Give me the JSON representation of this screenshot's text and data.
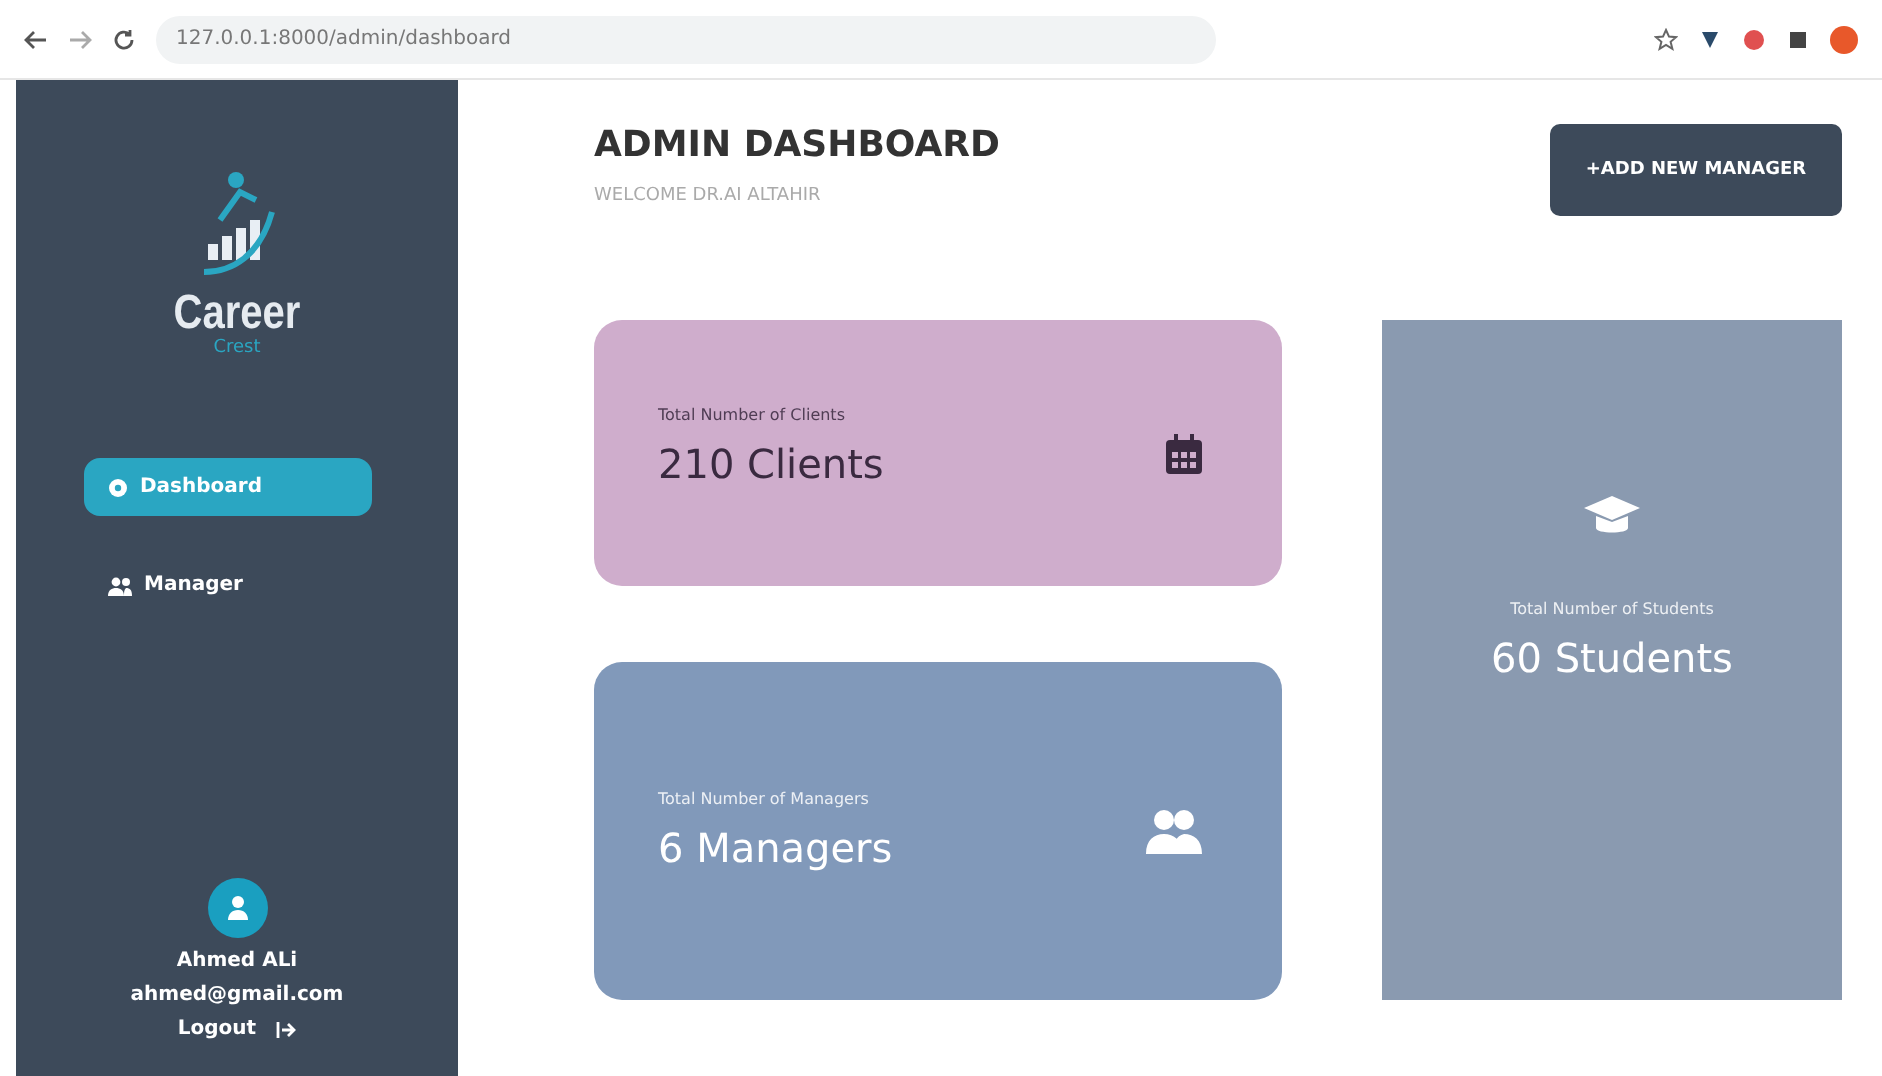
{
  "browser": {
    "url": "127.0.0.1:8000/admin/dashboard"
  },
  "sidebar": {
    "logo": {
      "title": "Career",
      "subtitle": "Crest"
    },
    "items": [
      {
        "label": "Dashboard",
        "selected": true
      },
      {
        "label": "Manager",
        "selected": false
      }
    ],
    "user": {
      "name": "Ahmed ALi",
      "email": "ahmed@gmail.com",
      "logout": "Logout"
    }
  },
  "header": {
    "title": "ADMIN DASHBOARD",
    "subtitle": "WELCOME DR.AI ALTAHIR",
    "button": "+ADD NEW MANAGER"
  },
  "cards": [
    {
      "kind": "row",
      "label": "Total Number of Clients",
      "value": "210 Clients",
      "color": "#cfadcc"
    },
    {
      "kind": "row",
      "label": "Total Number of Managers",
      "value": "6 Managers",
      "color": "#8199ba"
    },
    {
      "kind": "tall",
      "label": "Total Number of Students",
      "value": "60 Students",
      "color": "#8a9ab0"
    }
  ]
}
